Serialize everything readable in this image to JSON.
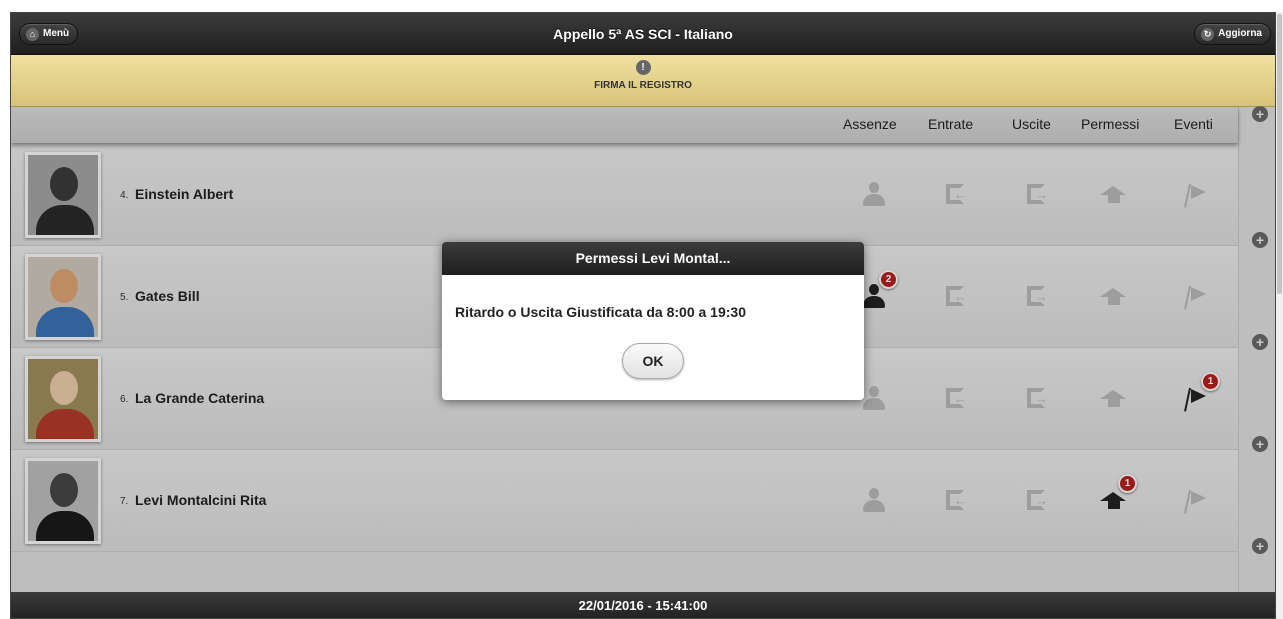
{
  "header": {
    "menu_label": "Menù",
    "menu_icon": "home-icon",
    "title": "Appello 5ª AS SCI - Italiano",
    "refresh_label": "Aggiorna",
    "refresh_icon": "refresh-icon"
  },
  "sign_bar": {
    "icon": "warning-icon",
    "label": "FIRMA IL REGISTRO",
    "color": "#d9c77e"
  },
  "columns": {
    "absences": "Assenze",
    "entries": "Entrate",
    "exits": "Uscite",
    "permissions": "Permessi",
    "events": "Eventi"
  },
  "students": [
    {
      "number": "",
      "name": "",
      "partial": true
    },
    {
      "number": "4.",
      "name": "Einstein Albert"
    },
    {
      "number": "5.",
      "name": "Gates Bill",
      "absences_badge": "2"
    },
    {
      "number": "6.",
      "name": "La Grande Caterina",
      "events_badge": "1"
    },
    {
      "number": "7.",
      "name": "Levi Montalcini Rita",
      "permissions_badge": "1"
    }
  ],
  "dialog": {
    "title": "Permessi Levi Montal...",
    "message": "Ritardo o Uscita Giustificata da 8:00 a 19:30",
    "ok_label": "OK"
  },
  "footer": {
    "datetime": "22/01/2016 - 15:41:00"
  },
  "colors": {
    "badge": "#b21e1e",
    "header": "#2b2b2b"
  }
}
